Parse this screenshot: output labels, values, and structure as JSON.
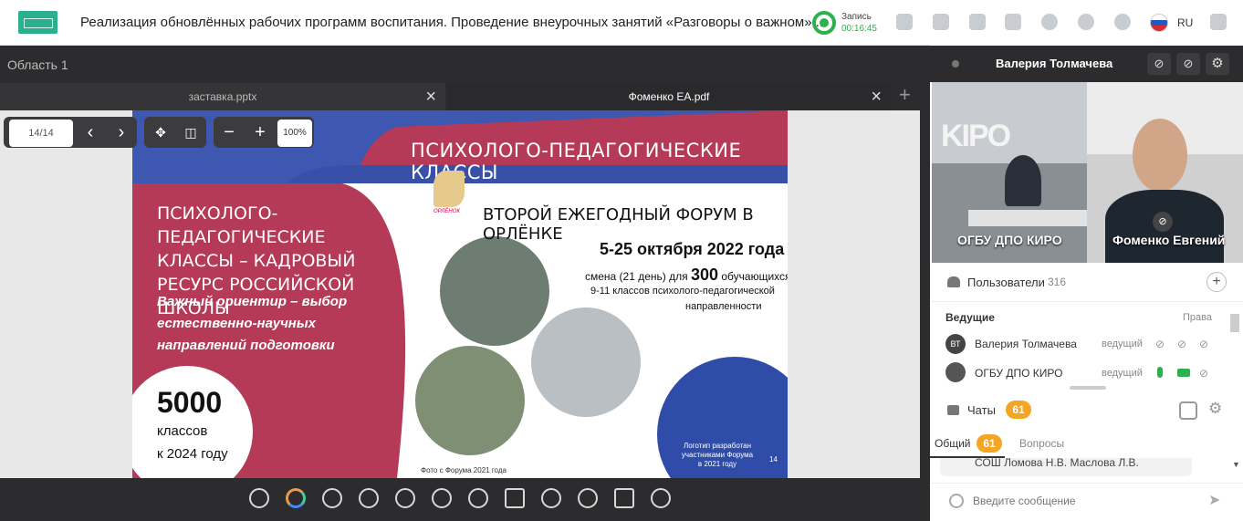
{
  "header": {
    "title": "Реализация обновлённых рабочих программ воспитания. Проведение внеурочных занятий «Разговоры о важном»...",
    "record_label": "Запись",
    "record_time": "00:16:45",
    "language": "RU"
  },
  "workspace": {
    "area_label": "Область 1",
    "tabs": [
      {
        "label": "заставка.pptx"
      },
      {
        "label": "Фоменко ЕА.pdf"
      }
    ],
    "page_indicator": "14/14",
    "zoom": "100%"
  },
  "slide": {
    "banner": "ПСИХОЛОГО-ПЕДАГОГИЧЕСКИЕ КЛАССЫ",
    "left_title": "ПСИХОЛОГО-ПЕДАГОГИЧЕСКИЕ КЛАССЫ – КАДРОВЫЙ РЕСУРС РОССИЙСКОЙ ШКОЛЫ",
    "left_subtitle": "Важный ориентир – выбор естественно-научных направлений подготовки",
    "count_big": "5000",
    "count_text_1": "классов",
    "count_text_2": "к 2024 году",
    "logo_caption": "ОРЛЁНОК",
    "forum_title": "ВТОРОЙ ЕЖЕГОДНЫЙ ФОРУМ В ОРЛЁНКЕ",
    "dates": "5-25 октября 2022 года",
    "shift_line": "смена (21 день) для 300 обучающихся",
    "shift_text_1": "смена (21 день) для",
    "shift_number": "300",
    "shift_text_2": "обучающихся",
    "grades_line_1": "9-11 классов психолого-педагогической",
    "grades_line_2": "направленности",
    "photo_caption": "Фото с Форума 2021 года",
    "emblem_text_1": "Логотип разработан",
    "emblem_text_2": "участниками Форума",
    "emblem_text_3": "в 2021 году",
    "page_number": "14"
  },
  "presenter": {
    "name": "Валерия Толмачева",
    "videos": [
      {
        "label": "ОГБУ ДПО КИРО"
      },
      {
        "label": "Фоменко Евгений"
      }
    ]
  },
  "users": {
    "label": "Пользователи",
    "count": "316",
    "hosts_label": "Ведущие",
    "rights_label": "Права",
    "list": [
      {
        "initials": "ВТ",
        "name": "Валерия Толмачева",
        "role": "ведущий"
      },
      {
        "initials": "",
        "name": "ОГБУ ДПО КИРО",
        "role": "ведущий"
      }
    ]
  },
  "chat": {
    "label": "Чаты",
    "count": "61",
    "tabs": [
      {
        "label": "Общий",
        "count": "61"
      },
      {
        "label": "Вопросы"
      }
    ],
    "message_preview": "СОШ Ломова Н.В. Маслова Л.В.",
    "input_placeholder": "Введите сообщение"
  }
}
